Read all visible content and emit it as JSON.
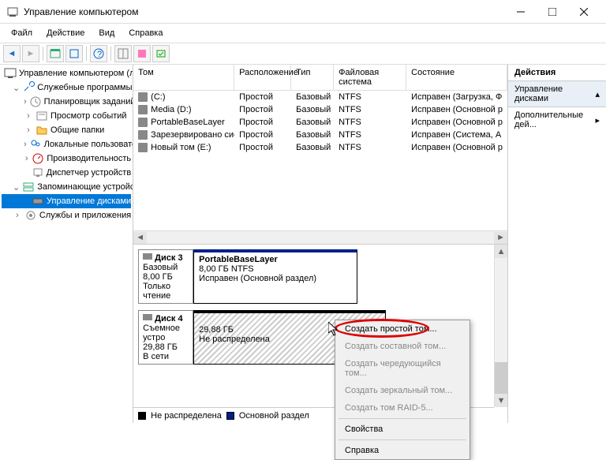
{
  "window": {
    "title": "Управление компьютером"
  },
  "menu": {
    "file": "Файл",
    "action": "Действие",
    "view": "Вид",
    "help": "Справка"
  },
  "tree": {
    "root": "Управление компьютером (локальным)",
    "util": "Служебные программы",
    "sched": "Планировщик заданий",
    "evt": "Просмотр событий",
    "shared": "Общие папки",
    "users": "Локальные пользователи и группы",
    "perf": "Производительность",
    "devmgr": "Диспетчер устройств",
    "storage": "Запоминающие устройства",
    "diskmgmt": "Управление дисками",
    "svc": "Службы и приложения"
  },
  "cols": {
    "vol": "Том",
    "layout": "Расположение",
    "type": "Тип",
    "fs": "Файловая система",
    "status": "Состояние"
  },
  "rows": [
    {
      "name": "(C:)",
      "layout": "Простой",
      "type": "Базовый",
      "fs": "NTFS",
      "status": "Исправен (Загрузка, Ф"
    },
    {
      "name": "Media (D:)",
      "layout": "Простой",
      "type": "Базовый",
      "fs": "NTFS",
      "status": "Исправен (Основной р"
    },
    {
      "name": "PortableBaseLayer",
      "layout": "Простой",
      "type": "Базовый",
      "fs": "NTFS",
      "status": "Исправен (Основной р"
    },
    {
      "name": "Зарезервировано системой",
      "layout": "Простой",
      "type": "Базовый",
      "fs": "NTFS",
      "status": "Исправен (Система, А"
    },
    {
      "name": "Новый том (E:)",
      "layout": "Простой",
      "type": "Базовый",
      "fs": "NTFS",
      "status": "Исправен (Основной р"
    }
  ],
  "disk3": {
    "name": "Диск 3",
    "type": "Базовый",
    "size": "8,00 ГБ",
    "ro": "Только чтение",
    "pname": "PortableBaseLayer",
    "pinfo": "8,00 ГБ NTFS",
    "pstat": "Исправен (Основной раздел)"
  },
  "disk4": {
    "name": "Диск 4",
    "type": "Съемное устро",
    "size": "29,88 ГБ",
    "online": "В сети",
    "psize": "29,88 ГБ",
    "pstat": "Не распределена"
  },
  "legend": {
    "unalloc": "Не распределена",
    "primary": "Основной раздел"
  },
  "actions": {
    "header": "Действия",
    "cat": "Управление дисками",
    "more": "Дополнительные дей..."
  },
  "ctx": {
    "simple": "Создать простой том...",
    "spanned": "Создать составной том...",
    "striped": "Создать чередующийся том...",
    "mirror": "Создать зеркальный том...",
    "raid5": "Создать том RAID-5...",
    "props": "Свойства",
    "help": "Справка"
  }
}
